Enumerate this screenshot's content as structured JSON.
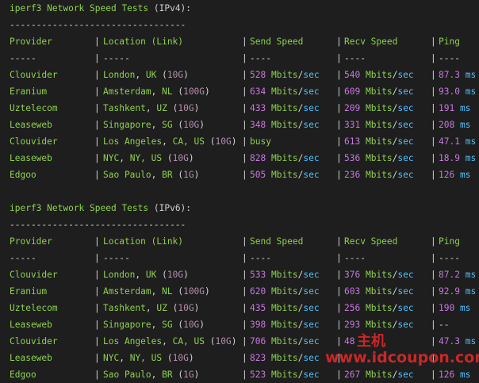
{
  "sections": [
    {
      "title_prefix": "iperf3 Network Speed Tests",
      "title_suffix": "(IPv4):",
      "dashes": "---------------------------------",
      "headers": [
        "Provider",
        "Location (Link)",
        "Send Speed",
        "Recv Speed",
        "Ping"
      ],
      "underlines": [
        "-----",
        "-----",
        "----",
        "----",
        "----"
      ],
      "rows": [
        {
          "provider": "Clouvider",
          "city": "London",
          "region": "UK",
          "link": "10G",
          "send": "528",
          "recv": "540",
          "ping": "87.3"
        },
        {
          "provider": "Eranium",
          "city": "Amsterdam",
          "region": "NL",
          "link": "100G",
          "send": "634",
          "recv": "609",
          "ping": "93.0"
        },
        {
          "provider": "Uztelecom",
          "city": "Tashkent",
          "region": "UZ",
          "link": "10G",
          "send": "433",
          "recv": "209",
          "ping": "191"
        },
        {
          "provider": "Leaseweb",
          "city": "Singapore",
          "region": "SG",
          "link": "10G",
          "send": "348",
          "recv": "331",
          "ping": "208"
        },
        {
          "provider": "Clouvider",
          "city": "Los Angeles",
          "region": "CA, US",
          "link": "10G",
          "send": "busy",
          "recv": "613",
          "ping": "47.1"
        },
        {
          "provider": "Leaseweb",
          "city": "NYC",
          "region": "NY, US",
          "link": "10G",
          "send": "828",
          "recv": "536",
          "ping": "18.9"
        },
        {
          "provider": "Edgoo",
          "city": "Sao Paulo",
          "region": "BR",
          "link": "1G",
          "send": "505",
          "recv": "236",
          "ping": "126"
        }
      ]
    },
    {
      "title_prefix": "iperf3 Network Speed Tests",
      "title_suffix": "(IPv6):",
      "dashes": "---------------------------------",
      "headers": [
        "Provider",
        "Location (Link)",
        "Send Speed",
        "Recv Speed",
        "Ping"
      ],
      "underlines": [
        "-----",
        "-----",
        "----",
        "----",
        "----"
      ],
      "rows": [
        {
          "provider": "Clouvider",
          "city": "London",
          "region": "UK",
          "link": "10G",
          "send": "533",
          "recv": "376",
          "ping": "87.2"
        },
        {
          "provider": "Eranium",
          "city": "Amsterdam",
          "region": "NL",
          "link": "100G",
          "send": "620",
          "recv": "603",
          "ping": "92.9"
        },
        {
          "provider": "Uztelecom",
          "city": "Tashkent",
          "region": "UZ",
          "link": "10G",
          "send": "435",
          "recv": "256",
          "ping": "190"
        },
        {
          "provider": "Leaseweb",
          "city": "Singapore",
          "region": "SG",
          "link": "10G",
          "send": "398",
          "recv": "293",
          "ping": "--"
        },
        {
          "provider": "Clouvider",
          "city": "Los Angeles",
          "region": "CA, US",
          "link": "10G",
          "send": "706",
          "recv": "48",
          "ping": "47.3"
        },
        {
          "provider": "Leaseweb",
          "city": "NYC",
          "region": "NY, US",
          "link": "10G",
          "send": "823",
          "recv": "",
          "ping": ""
        },
        {
          "provider": "Edgoo",
          "city": "Sao Paulo",
          "region": "BR",
          "link": "1G",
          "send": "523",
          "recv": "267",
          "ping": "126"
        }
      ]
    }
  ],
  "units": {
    "speed_word": "Mbits",
    "speed_slash": "/",
    "speed_sec": "sec",
    "ping": "ms"
  },
  "watermark": {
    "cn": "主机",
    "url": "www.idcoupon.com"
  },
  "colors": {
    "background": "#1e1e1e",
    "green": "#8fd14f",
    "purple": "#c678dd",
    "blue": "#4fc1ff",
    "watermark_red": "#eb2828"
  }
}
